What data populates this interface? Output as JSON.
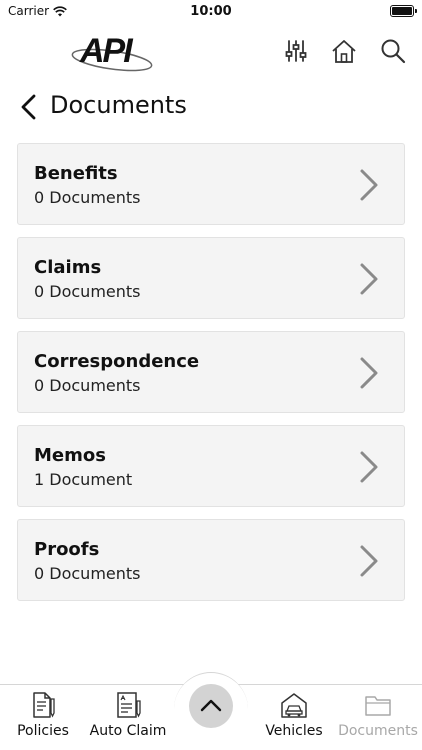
{
  "status_bar": {
    "carrier": "Carrier",
    "time": "10:00"
  },
  "header": {
    "logo_text": "API"
  },
  "page": {
    "title": "Documents"
  },
  "documents": [
    {
      "name": "Benefits",
      "count": "0 Documents"
    },
    {
      "name": "Claims",
      "count": "0 Documents"
    },
    {
      "name": "Correspondence",
      "count": "0 Documents"
    },
    {
      "name": "Memos",
      "count": "1 Document"
    },
    {
      "name": "Proofs",
      "count": "0 Documents"
    }
  ],
  "tab_bar": {
    "policies": "Policies",
    "auto_claim": "Auto Claim",
    "vehicles": "Vehicles",
    "documents": "Documents"
  },
  "colors": {
    "card_bg": "#f4f4f4",
    "chevron": "#8a8a8a",
    "inactive_tab": "#a8a8a8",
    "fab": "#d3d3d3"
  }
}
